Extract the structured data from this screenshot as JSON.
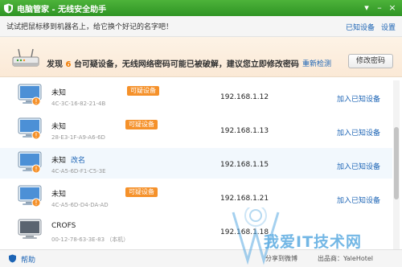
{
  "window": {
    "title": "电脑管家 - 无线安全助手",
    "controls": [
      "▾",
      "–",
      "×"
    ]
  },
  "hint": {
    "text": "试试把鼠标移到机器名上，给它换个好记的名字吧！",
    "links": [
      "已知设备",
      "设置"
    ]
  },
  "alert": {
    "prefix": "发现",
    "count": "6",
    "suffix": "台可疑设备，无线网络密码可能已被破解，建议您立即修改密码",
    "recheck_label": "重新检测",
    "change_password_label": "修改密码"
  },
  "devices": [
    {
      "name": "未知",
      "rename": "",
      "mac": "4C-3C-16-82-21-4B",
      "badge": "可疑设备",
      "ip": "192.168.1.12",
      "action": "加入已知设备"
    },
    {
      "name": "未知",
      "rename": "",
      "mac": "28-E3-1F-A9-A6-6D",
      "badge": "可疑设备",
      "ip": "192.168.1.13",
      "action": "加入已知设备"
    },
    {
      "name": "未知",
      "rename": "改名",
      "mac": "4C-A5-6D-F1-C5-3E",
      "badge": "",
      "ip": "192.168.1.15",
      "action": "加入已知设备"
    },
    {
      "name": "未知",
      "rename": "",
      "mac": "4C-A5-6D-D4-DA-AD",
      "badge": "可疑设备",
      "ip": "192.168.1.21",
      "action": "加入已知设备"
    },
    {
      "name": "CROFS",
      "rename": "",
      "mac": "00-12-78-63-3E-83 （本机）",
      "badge": "",
      "ip": "192.168.1.18",
      "action": ""
    }
  ],
  "footer": {
    "help_label": "帮助",
    "share_label": "分享到微博",
    "maker_label": "出品商：YaleHotel"
  },
  "watermark": {
    "text": "我爱IT技术网"
  },
  "colors": {
    "titlebar": "#3aa12c",
    "accent_link": "#1c64b5",
    "badge": "#f5912a",
    "warning_count": "#f07a00"
  }
}
